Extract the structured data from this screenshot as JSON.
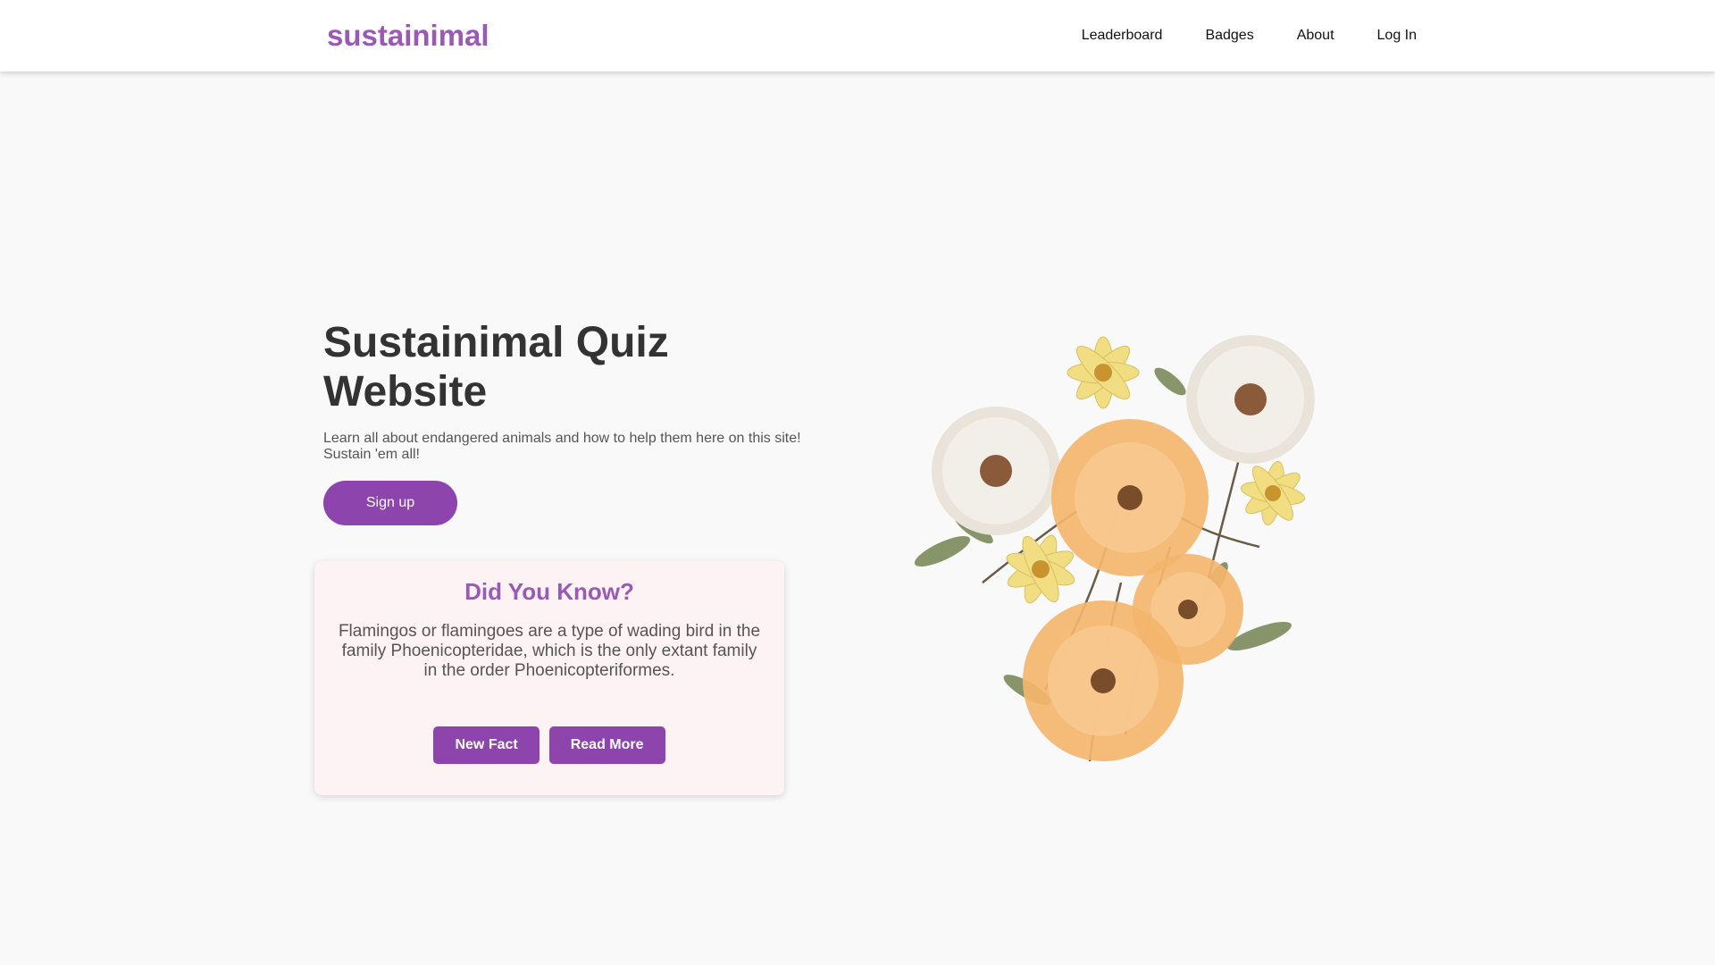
{
  "header": {
    "brand": "sustainimal",
    "nav": [
      {
        "label": "Leaderboard"
      },
      {
        "label": "Badges"
      },
      {
        "label": "About"
      },
      {
        "label": "Log In"
      }
    ]
  },
  "hero": {
    "title": "Sustainimal Quiz Website",
    "subtitle": "Learn all about endangered animals and how to help them here on this site! Sustain 'em all!",
    "signup_label": "Sign up",
    "image_icon": "pressed-flowers-illustration"
  },
  "fact": {
    "title": "Did You Know?",
    "text": "Flamingos or flamingoes are a type of wading bird in the family Phoenicopteridae, which is the only extant family in the order Phoenicopteriformes.",
    "new_fact_label": "New Fact",
    "read_more_label": "Read More"
  },
  "colors": {
    "brand": "#9b59b6",
    "button": "#8e44ad",
    "card_bg": "#fdf3f4",
    "page_bg": "#f9f9f9"
  }
}
